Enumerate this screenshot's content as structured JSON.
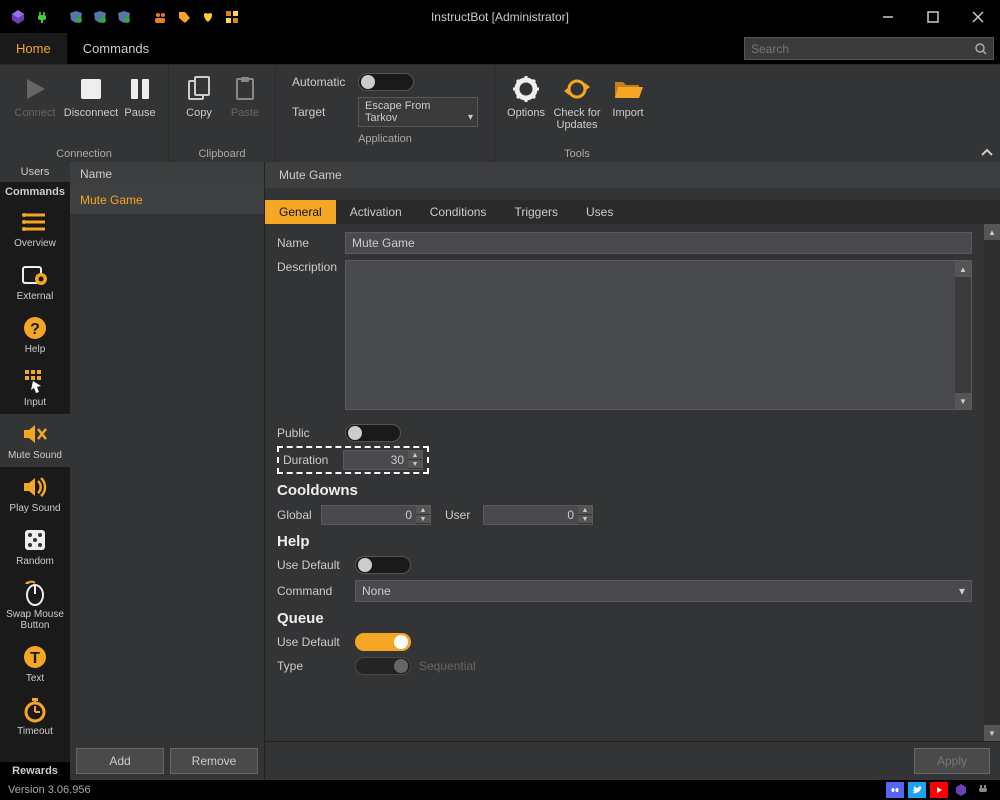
{
  "window": {
    "title": "InstructBot [Administrator]"
  },
  "tabs": {
    "home": "Home",
    "commands": "Commands"
  },
  "search": {
    "placeholder": "Search"
  },
  "ribbon": {
    "connection": {
      "label": "Connection",
      "connect": "Connect",
      "disconnect": "Disconnect",
      "pause": "Pause"
    },
    "clipboard": {
      "label": "Clipboard",
      "copy": "Copy",
      "paste": "Paste"
    },
    "application": {
      "label": "Application",
      "automatic": "Automatic",
      "target": "Target",
      "target_value": "Escape From Tarkov",
      "automatic_on": false
    },
    "tools": {
      "label": "Tools",
      "options": "Options",
      "check_updates": "Check for Updates",
      "import": "Import"
    }
  },
  "leftbar": {
    "tab_users": "Users",
    "tab_commands": "Commands",
    "tab_rewards": "Rewards",
    "items": [
      {
        "label": "Overview"
      },
      {
        "label": "External"
      },
      {
        "label": "Help"
      },
      {
        "label": "Input"
      },
      {
        "label": "Mute Sound"
      },
      {
        "label": "Play Sound"
      },
      {
        "label": "Random"
      },
      {
        "label": "Swap Mouse Button"
      },
      {
        "label": "Text"
      },
      {
        "label": "Timeout"
      }
    ]
  },
  "mid": {
    "header": "Name",
    "item": "Mute Game",
    "add": "Add",
    "remove": "Remove"
  },
  "main": {
    "title": "Mute Game",
    "tabs": {
      "general": "General",
      "activation": "Activation",
      "conditions": "Conditions",
      "triggers": "Triggers",
      "uses": "Uses"
    },
    "labels": {
      "name": "Name",
      "description": "Description",
      "public": "Public",
      "duration": "Duration",
      "cooldowns": "Cooldowns",
      "global": "Global",
      "user": "User",
      "help": "Help",
      "use_default": "Use Default",
      "command": "Command",
      "queue": "Queue",
      "type": "Type"
    },
    "values": {
      "name": "Mute Game",
      "description": "",
      "public": false,
      "duration": 30,
      "global": 0,
      "user": 0,
      "help_use_default": false,
      "command": "None",
      "queue_use_default": true,
      "type": "Sequential"
    },
    "apply": "Apply"
  },
  "statusbar": {
    "version": "Version 3.06.956"
  }
}
